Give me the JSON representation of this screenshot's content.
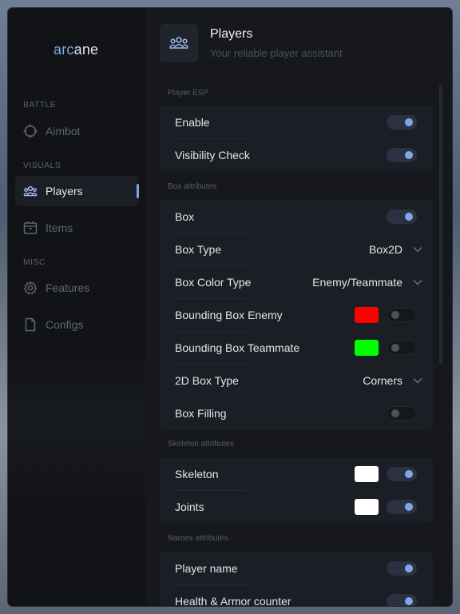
{
  "app": {
    "logo_part1": "arc",
    "logo_part2": "ane"
  },
  "sidebar": {
    "sections": [
      {
        "label": "BATTLE",
        "items": [
          {
            "label": "Aimbot",
            "icon": "crosshair-icon",
            "active": false
          }
        ]
      },
      {
        "label": "VISUALS",
        "items": [
          {
            "label": "Players",
            "icon": "users-icon",
            "active": true
          },
          {
            "label": "Items",
            "icon": "box-icon",
            "active": false
          }
        ]
      },
      {
        "label": "MISC",
        "items": [
          {
            "label": "Features",
            "icon": "gear-icon",
            "active": false
          },
          {
            "label": "Configs",
            "icon": "file-icon",
            "active": false
          }
        ]
      }
    ]
  },
  "header": {
    "title": "Players",
    "subtitle": "Your reliable player assistant",
    "icon": "users-icon"
  },
  "groups": [
    {
      "label": "Player ESP",
      "rows": [
        {
          "label": "Enable",
          "toggle": true
        },
        {
          "label": "Visibility Check",
          "toggle": true
        }
      ]
    },
    {
      "label": "Box attributes",
      "rows": [
        {
          "label": "Box",
          "toggle": true
        },
        {
          "label": "Box Type",
          "select": "Box2D"
        },
        {
          "label": "Box Color Type",
          "select": "Enemy/Teammate"
        },
        {
          "label": "Bounding Box Enemy",
          "color": "#ff0000",
          "toggle": false
        },
        {
          "label": "Bounding Box Teammate",
          "color": "#00ff00",
          "toggle": false
        },
        {
          "label": "2D Box Type",
          "select": "Corners"
        },
        {
          "label": "Box Filling",
          "toggle": false
        }
      ]
    },
    {
      "label": "Skeleton attributes",
      "rows": [
        {
          "label": "Skeleton",
          "color": "#ffffff",
          "toggle": true
        },
        {
          "label": "Joints",
          "color": "#ffffff",
          "toggle": true
        }
      ]
    },
    {
      "label": "Names attributes",
      "rows": [
        {
          "label": "Player name",
          "toggle": true
        },
        {
          "label": "Health & Armor counter",
          "toggle": true
        }
      ]
    }
  ],
  "colors": {
    "accent": "#7fa7e8",
    "sidebar_bg": "#111317",
    "main_bg": "#16181d",
    "card_bg": "#1b1e24"
  }
}
